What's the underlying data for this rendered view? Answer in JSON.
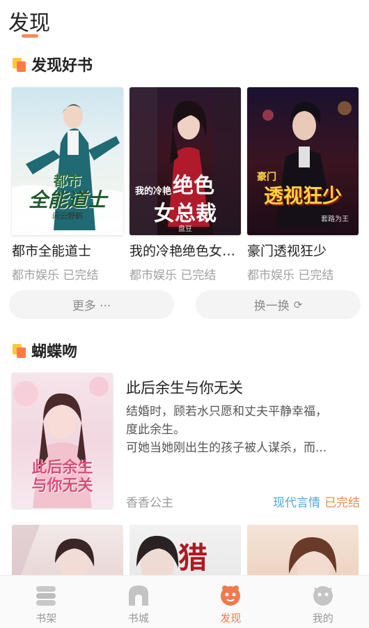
{
  "header": {
    "title": "发现"
  },
  "sections": [
    {
      "title": "发现好书",
      "icon": "section-flag-icon"
    },
    {
      "title": "蝴蝶吻",
      "icon": "section-flag-icon"
    }
  ],
  "book_grid": [
    {
      "name": "都市全能道士",
      "meta": "都市娱乐 已完结",
      "cover_lines": [
        "都市",
        "全能道士"
      ],
      "cover_author": "闲云野鹤"
    },
    {
      "name": "我的冷艳绝色女总裁",
      "meta": "都市娱乐 已完结",
      "cover_lines": [
        "我的冷艳",
        "绝色",
        "女总裁"
      ],
      "cover_author": "盘豆"
    },
    {
      "name": "豪门透视狂少",
      "meta": "都市娱乐 已完结",
      "cover_lines": [
        "豪门",
        "透视狂少"
      ],
      "cover_author": "套路为王"
    }
  ],
  "actions": {
    "more_label": "更多 ···",
    "shuffle_label": "换一换"
  },
  "featured": {
    "title": "此后余生与你无关",
    "desc_lines": [
      "结婚时，顾若水只愿和丈夫平静幸福，",
      "度此余生。",
      "可她当她刚出生的孩子被人谋杀，而..."
    ],
    "author": "香香公主",
    "genre": "现代言情",
    "status": "已完结",
    "cover_lines": [
      "此后余生",
      "与你无关"
    ]
  },
  "partial_covers": [
    {
      "cover_text": ""
    },
    {
      "cover_text": "猎"
    },
    {
      "cover_text": ""
    }
  ],
  "tabs": [
    {
      "label": "书架",
      "icon": "bookshelf-icon",
      "active": false
    },
    {
      "label": "书城",
      "icon": "bookstore-icon",
      "active": false
    },
    {
      "label": "发现",
      "icon": "discover-icon",
      "active": true
    },
    {
      "label": "我的",
      "icon": "profile-icon",
      "active": false
    }
  ],
  "colors": {
    "accent": "#f07a4d",
    "genre_tag": "#4fa7d8",
    "status_tag": "#f08a4b"
  }
}
